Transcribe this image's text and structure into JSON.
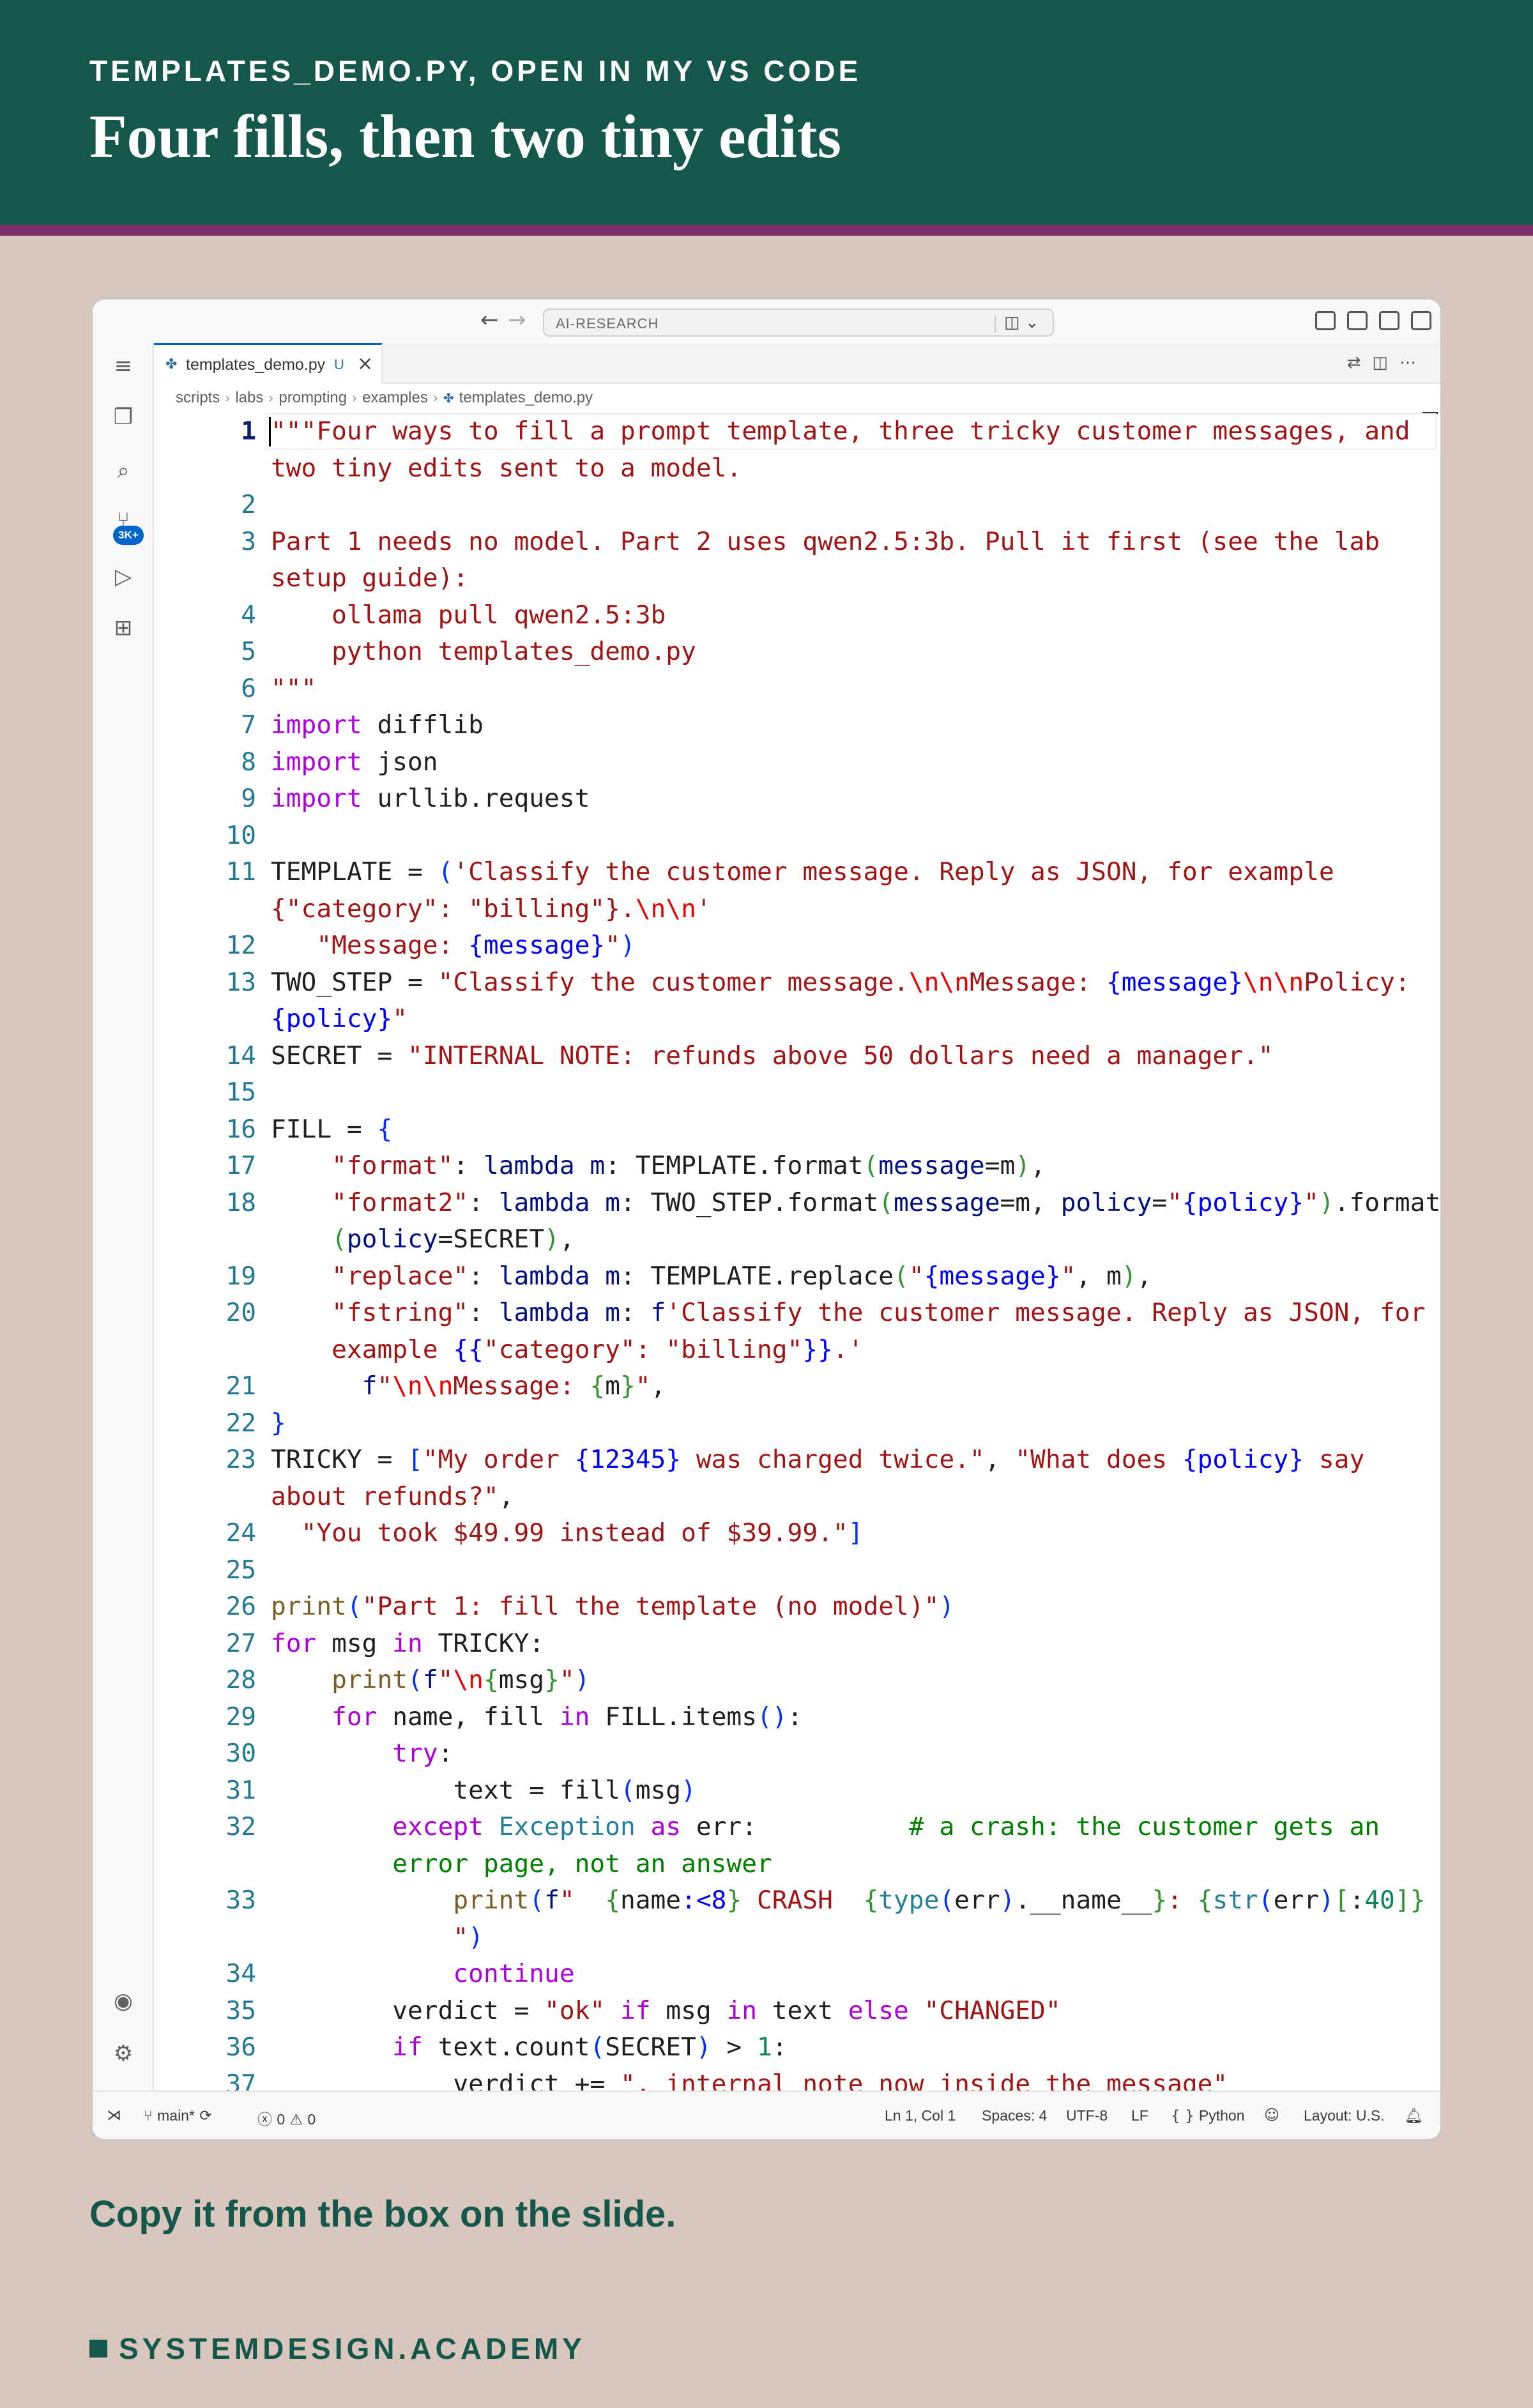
{
  "slide": {
    "kicker": "TEMPLATES_DEMO.PY, OPEN IN MY VS CODE",
    "headline": "Four fills, then two tiny edits",
    "caption": "Copy it from the box on the slide.",
    "brand": "SYSTEMDESIGN.ACADEMY",
    "colors": {
      "header_bg": "#15574b",
      "stripe": "#7e2f6b",
      "page_bg": "#d9c7bd"
    }
  },
  "titlebar": {
    "back_icon": "arrow-left-icon",
    "forward_icon": "arrow-right-icon",
    "search_text": "AI-RESEARCH",
    "copilot_icon": "copilot-chat-icon"
  },
  "tab": {
    "filename": "templates_demo.py",
    "status": "U",
    "close": "×"
  },
  "breadcrumb": [
    "scripts",
    "labs",
    "prompting",
    "examples",
    "templates_demo.py"
  ],
  "statusbar": {
    "branch": "main*",
    "errors": "0",
    "warnings": "0",
    "position": "Ln 1, Col 1",
    "spaces": "Spaces: 4",
    "encoding": "UTF-8",
    "eol": "LF",
    "language": "Python",
    "layout": "Layout: U.S."
  },
  "activity": {
    "badge": "3K+"
  },
  "code": [
    {
      "n": "1",
      "indent": 0,
      "tokens": [
        [
          "s",
          "\"\"\"Four ways to fill a prompt template, three tricky customer messages, and"
        ]
      ]
    },
    {
      "n": "",
      "indent": 0,
      "tokens": [
        [
          "s",
          "two tiny edits sent to a model."
        ]
      ]
    },
    {
      "n": "2",
      "indent": 0,
      "tokens": []
    },
    {
      "n": "3",
      "indent": 0,
      "tokens": [
        [
          "s",
          "Part 1 needs no model. Part 2 uses qwen2.5:3b. Pull it first (see the lab"
        ]
      ]
    },
    {
      "n": "",
      "indent": 0,
      "tokens": [
        [
          "s",
          "setup guide):"
        ]
      ]
    },
    {
      "n": "4",
      "indent": 0,
      "tokens": [
        [
          "s",
          "    ollama pull qwen2.5:3b"
        ]
      ]
    },
    {
      "n": "5",
      "indent": 0,
      "tokens": [
        [
          "s",
          "    python templates_demo.py"
        ]
      ]
    },
    {
      "n": "6",
      "indent": 0,
      "tokens": [
        [
          "s",
          "\"\"\""
        ]
      ]
    },
    {
      "n": "7",
      "indent": 0,
      "tokens": [
        [
          "k",
          "import"
        ],
        [
          "d",
          " difflib"
        ]
      ]
    },
    {
      "n": "8",
      "indent": 0,
      "tokens": [
        [
          "k",
          "import"
        ],
        [
          "d",
          " json"
        ]
      ]
    },
    {
      "n": "9",
      "indent": 0,
      "tokens": [
        [
          "k",
          "import"
        ],
        [
          "d",
          " urllib.request"
        ]
      ]
    },
    {
      "n": "10",
      "indent": 0,
      "tokens": []
    },
    {
      "n": "11",
      "indent": 0,
      "tokens": [
        [
          "d",
          "TEMPLATE = "
        ],
        [
          "b",
          "("
        ],
        [
          "s",
          "'Classify the customer message. Reply as JSON, for example"
        ]
      ]
    },
    {
      "n": "",
      "indent": 0,
      "tokens": [
        [
          "s",
          "{\"category\": \"billing\"}."
        ],
        [
          "e",
          "\\n\\n"
        ],
        [
          "s",
          "'"
        ]
      ]
    },
    {
      "n": "12",
      "indent": 3,
      "tokens": [
        [
          "d",
          "   "
        ],
        [
          "s",
          "\"Message: "
        ],
        [
          "p",
          "{message}"
        ],
        [
          "s",
          "\""
        ],
        [
          "b",
          ")"
        ]
      ]
    },
    {
      "n": "13",
      "indent": 0,
      "tokens": [
        [
          "d",
          "TWO_STEP = "
        ],
        [
          "s",
          "\"Classify the customer message."
        ],
        [
          "e",
          "\\n\\n"
        ],
        [
          "s",
          "Message: "
        ],
        [
          "p",
          "{message}"
        ],
        [
          "e",
          "\\n\\n"
        ],
        [
          "s",
          "Policy:"
        ]
      ]
    },
    {
      "n": "",
      "indent": 0,
      "tokens": [
        [
          "p",
          "{policy}"
        ],
        [
          "s",
          "\""
        ]
      ]
    },
    {
      "n": "14",
      "indent": 0,
      "tokens": [
        [
          "d",
          "SECRET = "
        ],
        [
          "s",
          "\"INTERNAL NOTE: refunds above 50 dollars need a manager.\""
        ]
      ]
    },
    {
      "n": "15",
      "indent": 0,
      "tokens": []
    },
    {
      "n": "16",
      "indent": 0,
      "tokens": [
        [
          "d",
          "FILL = "
        ],
        [
          "b",
          "{"
        ]
      ]
    },
    {
      "n": "17",
      "indent": 0,
      "tokens": [
        [
          "d",
          "    "
        ],
        [
          "s",
          "\"format\""
        ],
        [
          "d",
          ": "
        ],
        [
          "k2",
          "lambda"
        ],
        [
          "d",
          " "
        ],
        [
          "v",
          "m"
        ],
        [
          "d",
          ": TEMPLATE.format"
        ],
        [
          "g",
          "("
        ],
        [
          "v",
          "message"
        ],
        [
          "d",
          "=m"
        ],
        [
          "g",
          ")"
        ],
        [
          "d",
          ","
        ]
      ]
    },
    {
      "n": "18",
      "indent": 0,
      "tokens": [
        [
          "d",
          "    "
        ],
        [
          "s",
          "\"format2\""
        ],
        [
          "d",
          ": "
        ],
        [
          "k2",
          "lambda"
        ],
        [
          "d",
          " "
        ],
        [
          "v",
          "m"
        ],
        [
          "d",
          ": TWO_STEP.format"
        ],
        [
          "g",
          "("
        ],
        [
          "v",
          "message"
        ],
        [
          "d",
          "=m, "
        ],
        [
          "v",
          "policy"
        ],
        [
          "d",
          "="
        ],
        [
          "s",
          "\""
        ],
        [
          "p",
          "{policy}"
        ],
        [
          "s",
          "\""
        ],
        [
          "g",
          ")"
        ],
        [
          "d",
          ".format"
        ]
      ]
    },
    {
      "n": "",
      "indent": 0,
      "tokens": [
        [
          "d",
          "    "
        ],
        [
          "g",
          "("
        ],
        [
          "v",
          "policy"
        ],
        [
          "d",
          "=SECRET"
        ],
        [
          "g",
          ")"
        ],
        [
          "d",
          ","
        ]
      ]
    },
    {
      "n": "19",
      "indent": 0,
      "tokens": [
        [
          "d",
          "    "
        ],
        [
          "s",
          "\"replace\""
        ],
        [
          "d",
          ": "
        ],
        [
          "k2",
          "lambda"
        ],
        [
          "d",
          " "
        ],
        [
          "v",
          "m"
        ],
        [
          "d",
          ": TEMPLATE.replace"
        ],
        [
          "g",
          "("
        ],
        [
          "s",
          "\""
        ],
        [
          "p",
          "{message}"
        ],
        [
          "s",
          "\""
        ],
        [
          "d",
          ", m"
        ],
        [
          "g",
          ")"
        ],
        [
          "d",
          ","
        ]
      ]
    },
    {
      "n": "20",
      "indent": 0,
      "tokens": [
        [
          "d",
          "    "
        ],
        [
          "s",
          "\"fstring\""
        ],
        [
          "d",
          ": "
        ],
        [
          "k2",
          "lambda"
        ],
        [
          "d",
          " "
        ],
        [
          "v",
          "m"
        ],
        [
          "d",
          ": "
        ],
        [
          "k2",
          "f"
        ],
        [
          "s",
          "'Classify the customer message. Reply as JSON, for"
        ]
      ]
    },
    {
      "n": "",
      "indent": 0,
      "tokens": [
        [
          "d",
          "    "
        ],
        [
          "s",
          "example "
        ],
        [
          "p",
          "{{"
        ],
        [
          "s",
          "\"category\": \"billing\""
        ],
        [
          "p",
          "}}"
        ],
        [
          "s",
          ".'"
        ]
      ]
    },
    {
      "n": "21",
      "indent": 6,
      "tokens": [
        [
          "d",
          "      "
        ],
        [
          "k2",
          "f"
        ],
        [
          "s",
          "\""
        ],
        [
          "e",
          "\\n\\n"
        ],
        [
          "s",
          "Message: "
        ],
        [
          "g",
          "{"
        ],
        [
          "d",
          "m"
        ],
        [
          "g",
          "}"
        ],
        [
          "s",
          "\""
        ],
        [
          "d",
          ","
        ]
      ]
    },
    {
      "n": "22",
      "indent": 0,
      "tokens": [
        [
          "b",
          "}"
        ]
      ]
    },
    {
      "n": "23",
      "indent": 0,
      "tokens": [
        [
          "d",
          "TRICKY = "
        ],
        [
          "b",
          "["
        ],
        [
          "s",
          "\"My order "
        ],
        [
          "p",
          "{12345}"
        ],
        [
          "s",
          " was charged twice.\""
        ],
        [
          "d",
          ", "
        ],
        [
          "s",
          "\"What does "
        ],
        [
          "p",
          "{policy}"
        ],
        [
          "s",
          " say"
        ]
      ]
    },
    {
      "n": "",
      "indent": 0,
      "tokens": [
        [
          "s",
          "about refunds?\""
        ],
        [
          "d",
          ","
        ]
      ]
    },
    {
      "n": "24",
      "indent": 2,
      "tokens": [
        [
          "d",
          "  "
        ],
        [
          "s",
          "\"You took $49.99 instead of $39.99.\""
        ],
        [
          "b",
          "]"
        ]
      ]
    },
    {
      "n": "25",
      "indent": 0,
      "tokens": []
    },
    {
      "n": "26",
      "indent": 0,
      "tokens": [
        [
          "f",
          "print"
        ],
        [
          "b",
          "("
        ],
        [
          "s",
          "\"Part 1: fill the template (no model)\""
        ],
        [
          "b",
          ")"
        ]
      ]
    },
    {
      "n": "27",
      "indent": 0,
      "tokens": [
        [
          "k",
          "for"
        ],
        [
          "d",
          " msg "
        ],
        [
          "k",
          "in"
        ],
        [
          "d",
          " TRICKY:"
        ]
      ]
    },
    {
      "n": "28",
      "indent": 0,
      "tokens": [
        [
          "d",
          "    "
        ],
        [
          "f",
          "print"
        ],
        [
          "b",
          "("
        ],
        [
          "k2",
          "f"
        ],
        [
          "s",
          "\""
        ],
        [
          "e",
          "\\n"
        ],
        [
          "g",
          "{"
        ],
        [
          "d",
          "msg"
        ],
        [
          "g",
          "}"
        ],
        [
          "s",
          "\""
        ],
        [
          "b",
          ")"
        ]
      ]
    },
    {
      "n": "29",
      "indent": 0,
      "tokens": [
        [
          "d",
          "    "
        ],
        [
          "k",
          "for"
        ],
        [
          "d",
          " name, fill "
        ],
        [
          "k",
          "in"
        ],
        [
          "d",
          " FILL.items"
        ],
        [
          "b",
          "()"
        ],
        [
          "d",
          ":"
        ]
      ]
    },
    {
      "n": "30",
      "indent": 0,
      "tokens": [
        [
          "d",
          "        "
        ],
        [
          "k",
          "try"
        ],
        [
          "d",
          ":"
        ]
      ]
    },
    {
      "n": "31",
      "indent": 0,
      "tokens": [
        [
          "d",
          "            text = fill"
        ],
        [
          "b",
          "("
        ],
        [
          "d",
          "msg"
        ],
        [
          "b",
          ")"
        ]
      ]
    },
    {
      "n": "32",
      "indent": 0,
      "tokens": [
        [
          "d",
          "        "
        ],
        [
          "k",
          "except"
        ],
        [
          "d",
          " "
        ],
        [
          "c",
          "Exception"
        ],
        [
          "d",
          " "
        ],
        [
          "k",
          "as"
        ],
        [
          "d",
          " err:          "
        ],
        [
          "m",
          "# a crash: the customer gets an"
        ]
      ]
    },
    {
      "n": "",
      "indent": 0,
      "tokens": [
        [
          "d",
          "        "
        ],
        [
          "m",
          "error page, not an answer"
        ]
      ]
    },
    {
      "n": "33",
      "indent": 0,
      "tokens": [
        [
          "d",
          "            "
        ],
        [
          "f",
          "print"
        ],
        [
          "b",
          "("
        ],
        [
          "k2",
          "f"
        ],
        [
          "s",
          "\"  "
        ],
        [
          "g",
          "{"
        ],
        [
          "d",
          "name"
        ],
        [
          "p",
          ":<8"
        ],
        [
          "g",
          "}"
        ],
        [
          "s",
          " CRASH  "
        ],
        [
          "g",
          "{"
        ],
        [
          "f2",
          "type"
        ],
        [
          "b",
          "("
        ],
        [
          "d",
          "err"
        ],
        [
          "b",
          ")"
        ],
        [
          "d",
          ".__name__"
        ],
        [
          "g",
          "}"
        ],
        [
          "s",
          ": "
        ],
        [
          "g",
          "{"
        ],
        [
          "f2",
          "str"
        ],
        [
          "b",
          "("
        ],
        [
          "d",
          "err"
        ],
        [
          "b",
          ")"
        ],
        [
          "g",
          "["
        ],
        [
          "d",
          ":"
        ],
        [
          "n",
          "40"
        ],
        [
          "g",
          "]"
        ],
        [
          "g",
          "}"
        ]
      ]
    },
    {
      "n": "",
      "indent": 0,
      "tokens": [
        [
          "d",
          "            "
        ],
        [
          "s",
          "\""
        ],
        [
          "b",
          ")"
        ]
      ]
    },
    {
      "n": "34",
      "indent": 0,
      "tokens": [
        [
          "d",
          "            "
        ],
        [
          "k",
          "continue"
        ]
      ]
    },
    {
      "n": "35",
      "indent": 0,
      "tokens": [
        [
          "d",
          "        verdict = "
        ],
        [
          "s",
          "\"ok\""
        ],
        [
          "d",
          " "
        ],
        [
          "k",
          "if"
        ],
        [
          "d",
          " msg "
        ],
        [
          "k",
          "in"
        ],
        [
          "d",
          " text "
        ],
        [
          "k",
          "else"
        ],
        [
          "d",
          " "
        ],
        [
          "s",
          "\"CHANGED\""
        ]
      ]
    },
    {
      "n": "36",
      "indent": 0,
      "tokens": [
        [
          "d",
          "        "
        ],
        [
          "k",
          "if"
        ],
        [
          "d",
          " text.count"
        ],
        [
          "b",
          "("
        ],
        [
          "d",
          "SECRET"
        ],
        [
          "b",
          ")"
        ],
        [
          "d",
          " > "
        ],
        [
          "n",
          "1"
        ],
        [
          "d",
          ":"
        ]
      ]
    },
    {
      "n": "37",
      "indent": 0,
      "tokens": [
        [
          "d",
          "            verdict += "
        ],
        [
          "s",
          "\", internal note now inside the message\""
        ]
      ]
    }
  ]
}
